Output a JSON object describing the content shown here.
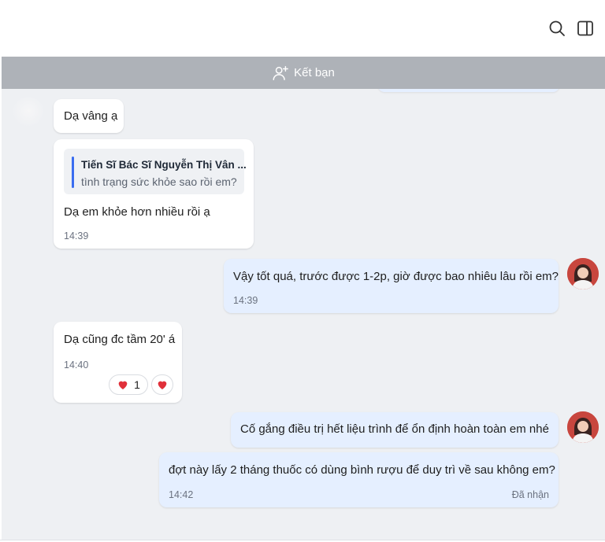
{
  "header": {
    "search_icon": "search-icon",
    "panel_icon": "sidebar-toggle-icon"
  },
  "friend_bar": {
    "label": "Kết bạn",
    "icon": "add-friend-icon"
  },
  "messages": [
    {
      "id": "m1",
      "direction": "in",
      "text": "Dạ vâng ạ"
    },
    {
      "id": "m2",
      "direction": "in",
      "quote": {
        "title": "Tiến Sĩ Bác Sĩ Nguyễn Thị Vân ...",
        "text": "tình trạng sức khỏe sao rồi em?"
      },
      "text": "Dạ em khỏe hơn nhiều rồi ạ",
      "time": "14:39"
    },
    {
      "id": "m3",
      "direction": "out",
      "text": "Vậy tốt quá, trước được 1-2p, giờ được bao nhiêu lâu rồi em?",
      "time": "14:39"
    },
    {
      "id": "m4",
      "direction": "in",
      "text": "Dạ cũng đc tầm 20' á",
      "time": "14:40",
      "reaction_count": "1"
    },
    {
      "id": "m5",
      "direction": "out",
      "text": "Cố gắng điều trị hết liệu trình để ổn định hoàn toàn em nhé"
    },
    {
      "id": "m6",
      "direction": "out",
      "text": "đợt này lấy 2 tháng thuốc có dùng bình rượu để duy trì về sau không em?",
      "time": "14:42",
      "status": "Đã nhận"
    }
  ],
  "colors": {
    "incoming_bubble": "#ffffff",
    "outgoing_bubble": "#e5efff",
    "chat_background": "#eef0f3",
    "friend_bar": "#aeb2b8",
    "quote_accent": "#3a6df0",
    "reaction_heart": "#e0303a"
  }
}
